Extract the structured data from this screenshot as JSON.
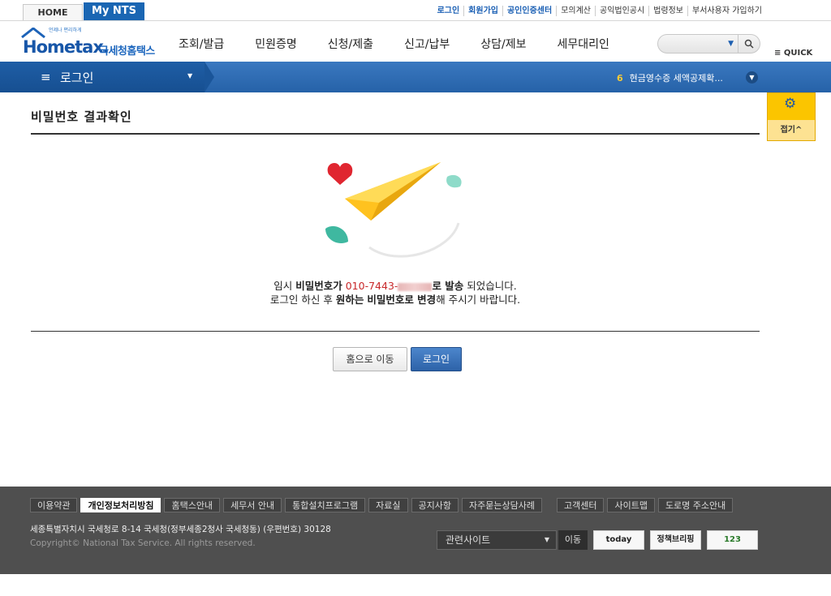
{
  "topbar": {
    "home": "HOME",
    "mynts": "My NTS",
    "links": [
      {
        "label": "로그인",
        "blue": true
      },
      {
        "label": "회원가입",
        "blue": true
      },
      {
        "label": "공인인증센터",
        "blue": true
      },
      {
        "label": "모의계산",
        "blue": false
      },
      {
        "label": "공익법인공시",
        "blue": false
      },
      {
        "label": "법령정보",
        "blue": false
      },
      {
        "label": "부서사용자 가입하기",
        "blue": false
      }
    ]
  },
  "header": {
    "logo_tag": "언제나 편리하게",
    "logo_en": "Hometax.",
    "logo_ko": "국세청홈택스",
    "gnb": [
      "조회/발급",
      "민원증명",
      "신청/제출",
      "신고/납부",
      "상담/제보",
      "세무대리인"
    ],
    "quick": "QUICK"
  },
  "navbar": {
    "menu_icon": "≡",
    "current": "로그인",
    "ticker_num": "6",
    "ticker_text": "현금영수증 세액공제확..."
  },
  "quickpanel": {
    "fold": "접기"
  },
  "main": {
    "title": "비밀번호 결과확인",
    "msg_line1_pre": "임시",
    "msg_line1_b1": "비밀번호가",
    "msg_line1_phone": "010-7443-",
    "msg_line1_b2": "로 발송",
    "msg_line1_post": "되었습니다.",
    "msg_line2_pre": "로그인 하신 후",
    "msg_line2_b1": "원하는",
    "msg_line2_b2": "비밀번호로 변경",
    "msg_line2_post": "해 주시기 바랍니다.",
    "btn_home": "홈으로 이동",
    "btn_login": "로그인"
  },
  "footer": {
    "links": [
      {
        "label": "이용약관",
        "bold": false
      },
      {
        "label": "개인정보처리방침",
        "bold": true
      },
      {
        "label": "홈택스안내",
        "bold": false
      },
      {
        "label": "세무서 안내",
        "bold": false
      },
      {
        "label": "통합설치프로그램",
        "bold": false
      },
      {
        "label": "자료실",
        "bold": false
      },
      {
        "label": "공지사항",
        "bold": false
      },
      {
        "label": "자주묻는상담사례",
        "bold": false
      },
      {
        "label": "고객센터",
        "bold": false
      },
      {
        "label": "사이트맵",
        "bold": false
      },
      {
        "label": "도로명 주소안내",
        "bold": false
      }
    ],
    "address": "세종특별자치시 국세청로 8-14 국세청(정부세종2청사 국세청동) (우편번호) 30128",
    "copyright": "Copyright© National Tax Service. All rights reserved.",
    "related": "관련사이트",
    "go": "이동",
    "banners": [
      "today",
      "정책브리핑",
      "123"
    ]
  }
}
